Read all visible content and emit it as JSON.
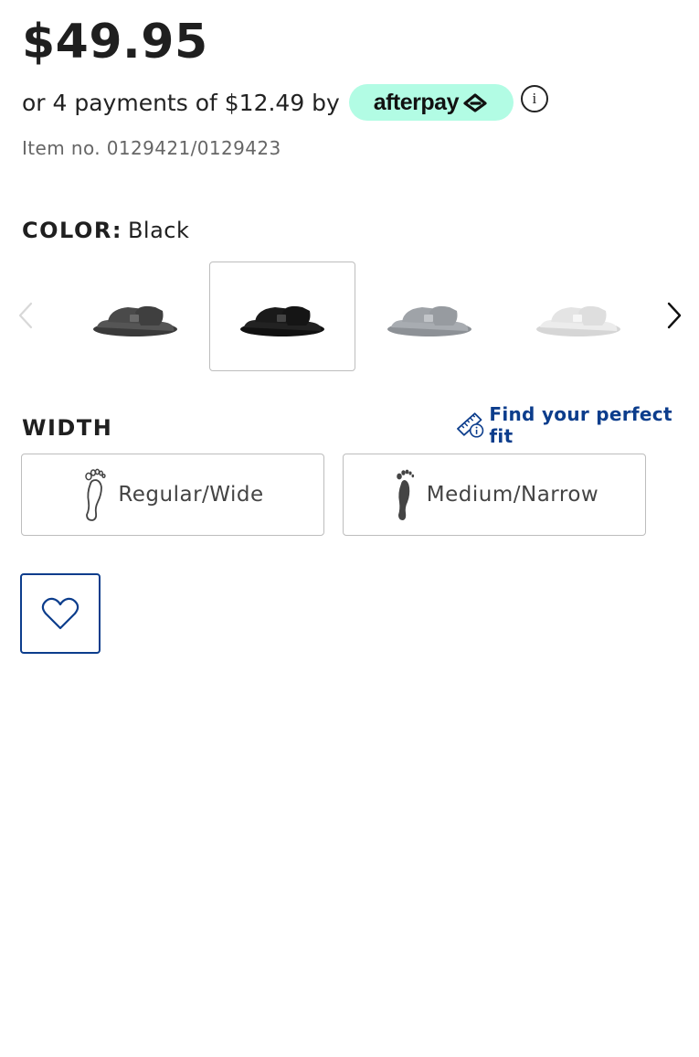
{
  "product": {
    "price": "$49.95",
    "item_number": "Item no. 0129421/0129423"
  },
  "payments": {
    "text": "or 4 payments of $12.49 by",
    "provider": "afterpay",
    "provider_color": "#b2fce4"
  },
  "color": {
    "label": "COLOR:",
    "value": "Black",
    "swatches": [
      {
        "name": "Anthracite",
        "shade": "#4a4a4a",
        "selected": false
      },
      {
        "name": "Black",
        "shade": "#1e1e1e",
        "selected": true
      },
      {
        "name": "Gray",
        "shade": "#9fa3a8",
        "selected": false
      },
      {
        "name": "White",
        "shade": "#e9e9e9",
        "selected": false
      }
    ]
  },
  "width": {
    "label": "WIDTH",
    "fit_link": "Find your perfect fit",
    "options": [
      {
        "label": "Regular/Wide",
        "icon": "foot-outline-icon"
      },
      {
        "label": "Medium/Narrow",
        "icon": "foot-filled-icon"
      }
    ]
  },
  "icons": {
    "info": "i",
    "accent": "#0c3d8c"
  }
}
